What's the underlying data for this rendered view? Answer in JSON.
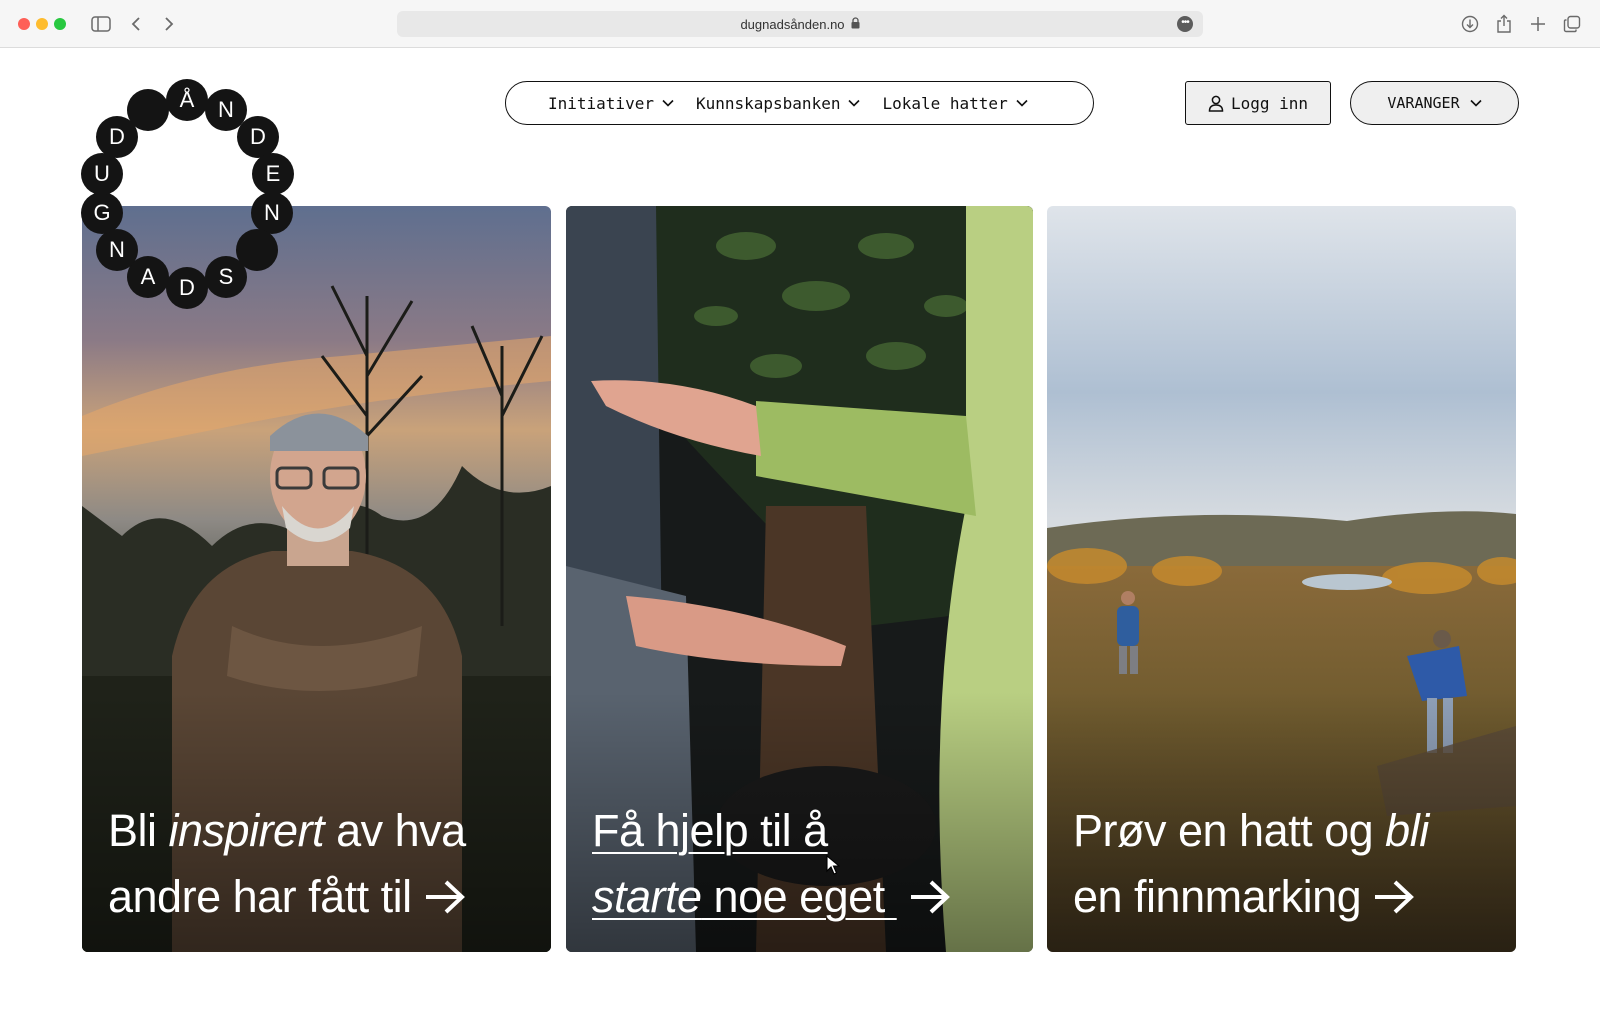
{
  "browser": {
    "url": "dugnadsånden.no",
    "more_glyph": "•••"
  },
  "logo": {
    "letters": [
      "Å",
      "N",
      "D",
      "E",
      "N",
      "",
      "S",
      "D",
      "A",
      "N",
      "G",
      "U",
      "D",
      ""
    ]
  },
  "nav": {
    "items": [
      {
        "label": "Initiativer"
      },
      {
        "label": "Kunnskapsbanken"
      },
      {
        "label": "Lokale hatter"
      }
    ],
    "login_label": "Logg inn",
    "region_label": "VARANGER"
  },
  "cards": [
    {
      "line1_a": "Bli ",
      "line1_em": "inspirert",
      "line1_b": " av hva",
      "line2": "andre har fått til"
    },
    {
      "line1": "Få hjelp til å",
      "line2_em": "starte",
      "line2_b": " noe eget "
    },
    {
      "line1_a": "Prøv en hatt og ",
      "line1_em": "bli",
      "line2": "en finnmarking"
    }
  ],
  "colors": {
    "ink": "#111111",
    "card_text": "#ffffff"
  }
}
